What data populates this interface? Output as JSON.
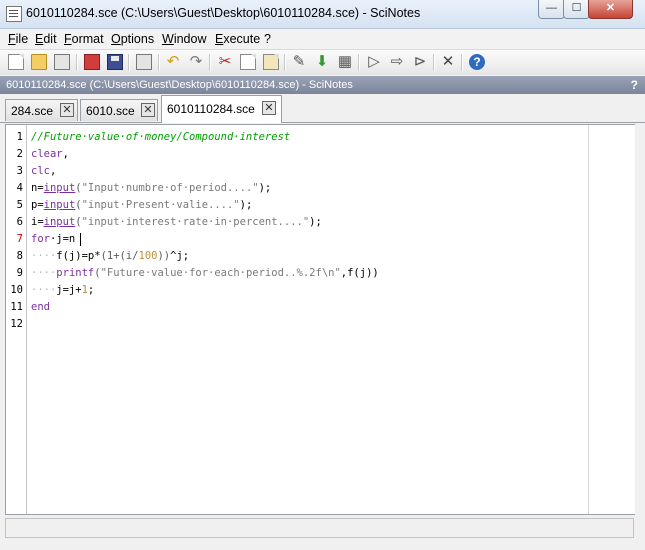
{
  "window": {
    "title": "6010110284.sce (C:\\Users\\Guest\\Desktop\\6010110284.sce) - SciNotes",
    "minimize_glyph": "—",
    "maximize_glyph": "☐",
    "close_glyph": "✕"
  },
  "menu": [
    "File",
    "Edit",
    "Format",
    "Options",
    "Window",
    "Execute",
    "?"
  ],
  "toolbar": {
    "icons": [
      "new-file-icon",
      "open-file-icon",
      "open-in-browser-icon",
      "save-icon",
      "save-as-icon",
      "print-icon",
      "undo-icon",
      "redo-icon",
      "cut-icon",
      "copy-icon",
      "paste-icon",
      "rename-icon",
      "execute-file-icon",
      "load-into-scilab-icon",
      "execute-icon",
      "execute-selection-icon",
      "execute-until-caret-icon",
      "settings-icon",
      "help-icon"
    ]
  },
  "doc_header": {
    "text": "6010110284.sce (C:\\Users\\Guest\\Desktop\\6010110284.sce) - SciNotes",
    "help": "?"
  },
  "tabs": [
    {
      "label": "284.sce",
      "active": false
    },
    {
      "label": "6010.sce",
      "active": false
    },
    {
      "label": "6010110284.sce",
      "active": true
    }
  ],
  "editor": {
    "line_numbers": [
      "1",
      "2",
      "3",
      "4",
      "5",
      "6",
      "7",
      "8",
      "9",
      "10",
      "11",
      "12"
    ],
    "current_line": "7",
    "lines": [
      {
        "indent": "",
        "tokens": [
          {
            "t": "//Future·value·of·money/Compound·interest",
            "c": "comment"
          }
        ]
      },
      {
        "indent": "",
        "tokens": [
          {
            "t": "clear",
            "c": "cmd"
          },
          {
            "t": ",",
            "c": "plain"
          }
        ]
      },
      {
        "indent": "",
        "tokens": [
          {
            "t": "clc",
            "c": "cmd"
          },
          {
            "t": ",",
            "c": "plain"
          }
        ]
      },
      {
        "indent": "",
        "tokens": [
          {
            "t": "n=",
            "c": "plain"
          },
          {
            "t": "input",
            "c": "func"
          },
          {
            "t": "(",
            "c": "paren"
          },
          {
            "t": "\"Input·numbre·of·period....\"",
            "c": "str"
          },
          {
            "t": ");",
            "c": "plain"
          }
        ]
      },
      {
        "indent": "",
        "tokens": [
          {
            "t": "p=",
            "c": "plain"
          },
          {
            "t": "input",
            "c": "func"
          },
          {
            "t": "(",
            "c": "paren"
          },
          {
            "t": "\"input·Present·valie....\"",
            "c": "str"
          },
          {
            "t": ");",
            "c": "plain"
          }
        ]
      },
      {
        "indent": "",
        "tokens": [
          {
            "t": "i=",
            "c": "plain"
          },
          {
            "t": "input",
            "c": "func"
          },
          {
            "t": "(",
            "c": "paren"
          },
          {
            "t": "\"input·interest·rate·in·percent....\"",
            "c": "str"
          },
          {
            "t": ");",
            "c": "plain"
          }
        ]
      },
      {
        "indent": "",
        "tokens": [
          {
            "t": "for",
            "c": "kw"
          },
          {
            "t": "·j=n",
            "c": "plain"
          }
        ]
      },
      {
        "indent": "····",
        "tokens": [
          {
            "t": "f(j)=p*",
            "c": "plain"
          },
          {
            "t": "(1+(i/",
            "c": "paren"
          },
          {
            "t": "100",
            "c": "num"
          },
          {
            "t": "))",
            "c": "paren"
          },
          {
            "t": "^j;",
            "c": "plain"
          }
        ]
      },
      {
        "indent": "····",
        "tokens": [
          {
            "t": "printf",
            "c": "cmd"
          },
          {
            "t": "(",
            "c": "paren"
          },
          {
            "t": "\"Future·value·for·each·period..%.2f\\n\"",
            "c": "str"
          },
          {
            "t": ",f(j))",
            "c": "plain"
          }
        ]
      },
      {
        "indent": "····",
        "tokens": [
          {
            "t": "j=j+",
            "c": "plain"
          },
          {
            "t": "1",
            "c": "num"
          },
          {
            "t": ";",
            "c": "plain"
          }
        ]
      },
      {
        "indent": "",
        "tokens": [
          {
            "t": "end",
            "c": "kw"
          }
        ]
      },
      {
        "indent": "",
        "tokens": []
      }
    ]
  },
  "colors": {
    "comment": "#00a000",
    "keyword": "#7c30a0",
    "string": "#7a7a7a",
    "number": "#bc8f3d",
    "current_line_number": "#d00000"
  }
}
